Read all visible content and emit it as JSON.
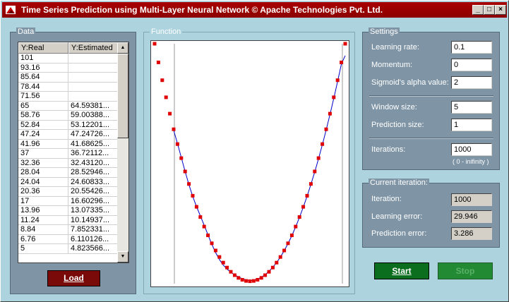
{
  "window": {
    "title": "Time Series Prediction using Multi-Layer Neural Network © Apache Technologies Pvt. Ltd.",
    "controls": [
      "minimize",
      "maximize",
      "close"
    ]
  },
  "data_panel": {
    "title": "Data",
    "columns": [
      "Y:Real",
      "Y:Estimated"
    ],
    "rows": [
      [
        "101",
        ""
      ],
      [
        "93.16",
        ""
      ],
      [
        "85.64",
        ""
      ],
      [
        "78.44",
        ""
      ],
      [
        "71.56",
        ""
      ],
      [
        "65",
        "64.59381..."
      ],
      [
        "58.76",
        "59.00388..."
      ],
      [
        "52.84",
        "53.12201..."
      ],
      [
        "47.24",
        "47.24726..."
      ],
      [
        "41.96",
        "41.68625..."
      ],
      [
        "37",
        "36.72112..."
      ],
      [
        "32.36",
        "32.43120..."
      ],
      [
        "28.04",
        "28.52946..."
      ],
      [
        "24.04",
        "24.60833..."
      ],
      [
        "20.36",
        "20.55426..."
      ],
      [
        "17",
        "16.60296..."
      ],
      [
        "13.96",
        "13.07335..."
      ],
      [
        "11.24",
        "10.14937..."
      ],
      [
        "8.84",
        "7.852331..."
      ],
      [
        "6.76",
        "6.110126..."
      ],
      [
        "5",
        "4.823566..."
      ]
    ],
    "load_button": "Load"
  },
  "function_panel": {
    "title": "Function",
    "chart_data": {
      "type": "scatter",
      "series": [
        {
          "kind": "points",
          "color": "#e00000",
          "x": [
            0,
            1,
            2,
            3,
            4,
            5,
            6,
            7,
            8,
            9,
            10,
            11,
            12,
            13,
            14,
            15,
            16,
            17,
            18,
            19,
            20,
            21,
            22,
            23,
            24,
            25,
            26,
            27,
            28,
            29,
            30,
            31,
            32,
            33,
            34,
            35,
            36,
            37,
            38,
            39,
            40,
            41,
            42,
            43,
            44,
            45,
            46,
            47,
            48,
            49,
            50
          ],
          "y": [
            101,
            93.16,
            85.64,
            78.44,
            71.56,
            65,
            58.76,
            52.84,
            47.24,
            41.96,
            37,
            32.36,
            28.04,
            24.04,
            20.36,
            17,
            13.96,
            11.24,
            8.84,
            6.76,
            5,
            3.56,
            2.44,
            1.64,
            1.16,
            1,
            1.16,
            1.64,
            2.44,
            3.56,
            5,
            6.76,
            8.84,
            11.24,
            13.96,
            17,
            20.36,
            24.04,
            28.04,
            32.36,
            37,
            41.96,
            47.24,
            52.84,
            58.76,
            65,
            71.56,
            78.44,
            85.64,
            93.16,
            101
          ]
        },
        {
          "kind": "line",
          "color": "#0000c8",
          "x": [
            5,
            6,
            7,
            8,
            9,
            10,
            11,
            12,
            13,
            14,
            15,
            16,
            17,
            18,
            19,
            20,
            21,
            22,
            23,
            24,
            25,
            26,
            27,
            28,
            29,
            30,
            31,
            32,
            33,
            34,
            35,
            36,
            37,
            38,
            39,
            40,
            41,
            42,
            43,
            44,
            45,
            46,
            47,
            48,
            49,
            50
          ],
          "y": [
            64.59,
            59.0,
            53.12,
            47.25,
            41.69,
            36.72,
            32.43,
            28.53,
            24.61,
            20.55,
            16.6,
            13.07,
            10.15,
            7.85,
            6.11,
            4.82,
            3.7,
            2.8,
            2.1,
            1.6,
            1.3,
            1.4,
            1.9,
            2.7,
            3.8,
            5.2,
            6.9,
            8.9,
            11.2,
            13.9,
            16.9,
            20.2,
            23.9,
            27.9,
            32.2,
            36.8,
            41.8,
            47.0,
            52.6,
            58.5,
            64.7,
            71.2,
            78.0,
            85.1,
            92.5,
            96.0
          ]
        }
      ],
      "xlim": [
        0,
        50
      ],
      "ylim": [
        0,
        101
      ],
      "grid": false
    }
  },
  "settings": {
    "title": "Settings",
    "learning_rate_label": "Learning rate:",
    "learning_rate": "0.1",
    "momentum_label": "Momentum:",
    "momentum": "0",
    "sigmoid_label": "Sigmoid's alpha value:",
    "sigmoid": "2",
    "window_size_label": "Window size:",
    "window_size": "5",
    "prediction_size_label": "Prediction size:",
    "prediction_size": "1",
    "iterations_label": "Iterations:",
    "iterations": "1000",
    "iterations_hint": "( 0 - inifinity )"
  },
  "current_iteration": {
    "title": "Current iteration:",
    "iteration_label": "Iteration:",
    "iteration": "1000",
    "learning_error_label": "Learning error:",
    "learning_error": "29.946",
    "prediction_error_label": "Prediction error:",
    "prediction_error": "3.286"
  },
  "buttons": {
    "start": "Start",
    "stop": "Stop"
  }
}
